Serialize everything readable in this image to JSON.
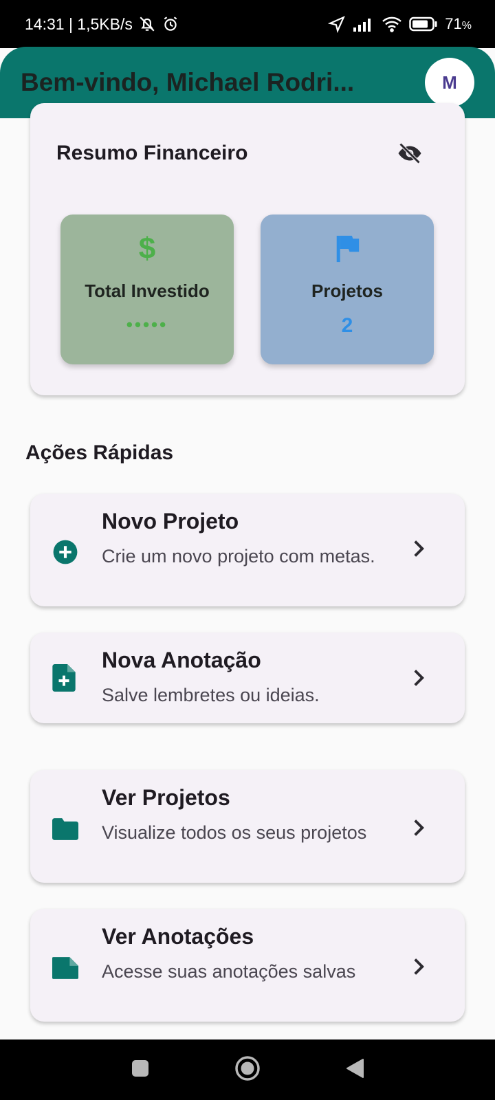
{
  "status_bar": {
    "time_speed": "14:31 | 1,5KB/s",
    "battery_pct": "71",
    "battery_unit": "%"
  },
  "app_bar": {
    "title": "Bem-vindo, Michael Rodri...",
    "avatar_initial": "M"
  },
  "summary": {
    "title": "Resumo Financeiro",
    "visibility_icon": "eye-off-icon",
    "total_invested": {
      "icon": "dollar-icon",
      "label": "Total Investido",
      "value": "•••••",
      "color": "#4db04a"
    },
    "projects": {
      "icon": "flag-icon",
      "label": "Projetos",
      "value": "2",
      "color": "#2f8fe6"
    }
  },
  "quick_actions": {
    "title": "Ações Rápidas",
    "items": [
      {
        "icon": "add-circle-icon",
        "title": "Novo Projeto",
        "description": "Crie um novo projeto com metas."
      },
      {
        "icon": "note-add-icon",
        "title": "Nova Anotação",
        "description": "Salve lembretes ou ideias."
      },
      {
        "icon": "folder-icon",
        "title": "Ver Projetos",
        "description": "Visualize todos os seus projetos"
      },
      {
        "icon": "note-icon",
        "title": "Ver Anotações",
        "description": "Acesse suas anotações salvas"
      }
    ]
  },
  "colors": {
    "primary": "#0a766c",
    "card_background": "#f5f1f7",
    "invest_box": "#9cb59b",
    "projects_box": "#93afcf"
  }
}
